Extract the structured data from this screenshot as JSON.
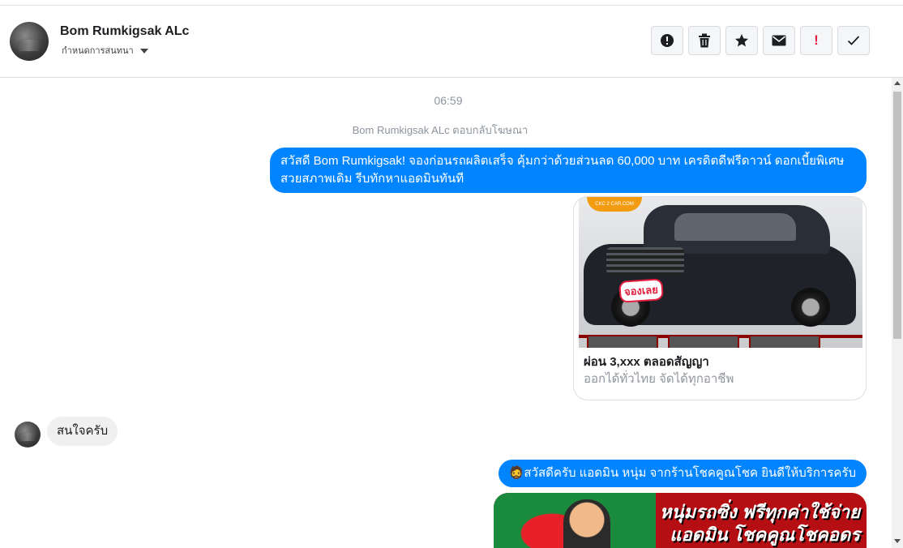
{
  "header": {
    "contact_name": "Bom Rumkigsak ALc",
    "status_label": "กำหนดการสนทนา",
    "actions": [
      {
        "icon": "alert-circle-icon",
        "name": "report-button"
      },
      {
        "icon": "trash-icon",
        "name": "delete-button"
      },
      {
        "icon": "star-icon",
        "name": "star-button"
      },
      {
        "icon": "envelope-icon",
        "name": "mark-unread-button"
      },
      {
        "icon": "exclamation-icon",
        "name": "spam-button"
      },
      {
        "icon": "check-icon",
        "name": "mark-done-button"
      }
    ]
  },
  "conversation": {
    "timestamp": "06:59",
    "reply_note": "Bom Rumkigsak ALc ตอบกลับโฆษณา",
    "messages": {
      "outgoing_1": "สวัสดี Bom Rumkigsak! จองก่อนรถผลิตเสร็จ คุ้มกว่าด้วยส่วนลด 60,000 บาท เครดิตดีฟรีดาวน์ ดอกเบี้ยพิเศษ สวยสภาพเดิม รีบทักหาแอดมินทันที",
      "ad_card": {
        "title": "ผ่อน 3,xxx ตลอดสัญญา",
        "subtitle": "ออกได้ทั่วไทย จัดได้ทุกอาชีพ",
        "image_logo_text": "CKC 2 CAR.COM",
        "image_sticker_text": "จองเลย"
      },
      "incoming_1": "สนใจครับ",
      "outgoing_2_emoji": "🧔",
      "outgoing_2": "สวัสดีครับ แอดมิน หนุ่ม จากร้านโชคคูณโชค ยินดีให้บริการครับ",
      "banner_text_line1": "หนุ่มรถซิ่ง ฟรีทุกค่าใช้จ่าย",
      "banner_text_line2": "แอดมิน โชคคูณโชคอดร"
    }
  },
  "colors": {
    "outgoing_bubble": "#0084ff",
    "incoming_bubble": "#f1f0f0",
    "danger": "#e41e3f"
  }
}
